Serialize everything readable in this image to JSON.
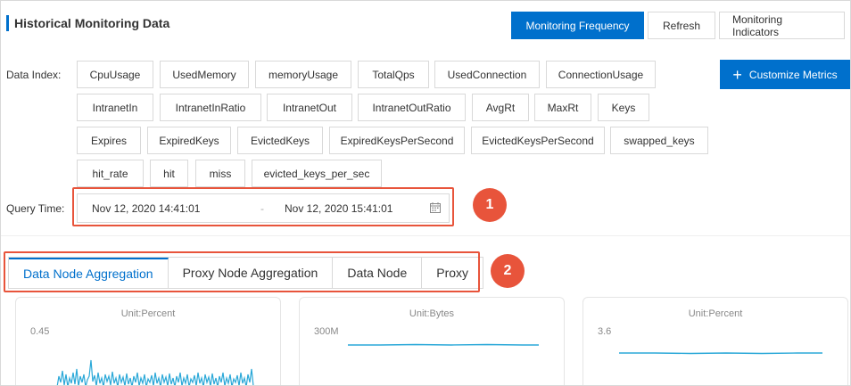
{
  "header": {
    "title": "Historical Monitoring Data",
    "buttons": [
      "Monitoring Frequency",
      "Refresh",
      "Monitoring Indicators"
    ]
  },
  "data_index": {
    "label": "Data Index:",
    "tags": [
      "CpuUsage",
      "UsedMemory",
      "memoryUsage",
      "TotalQps",
      "UsedConnection",
      "ConnectionUsage",
      "IntranetIn",
      "IntranetInRatio",
      "IntranetOut",
      "IntranetOutRatio",
      "AvgRt",
      "MaxRt",
      "Keys",
      "Expires",
      "ExpiredKeys",
      "EvictedKeys",
      "ExpiredKeysPerSecond",
      "EvictedKeysPerSecond",
      "swapped_keys",
      "hit_rate",
      "hit",
      "miss",
      "evicted_keys_per_sec"
    ],
    "customize_label": "Customize Metrics"
  },
  "query_time": {
    "label": "Query Time:",
    "start": "Nov 12, 2020 14:41:01",
    "separator": "-",
    "end": "Nov 12, 2020 15:41:01"
  },
  "callouts": [
    "1",
    "2"
  ],
  "tabs": [
    "Data Node Aggregation",
    "Proxy Node Aggregation",
    "Data Node",
    "Proxy"
  ],
  "active_tab": "Data Node Aggregation",
  "charts": [
    {
      "unit": "Unit:Percent",
      "tick": "0.45"
    },
    {
      "unit": "Unit:Bytes",
      "tick": "300M"
    },
    {
      "unit": "Unit:Percent",
      "tick": "3.6"
    }
  ],
  "colors": {
    "primary": "#0070cc",
    "callout": "#e8543b",
    "series": "#2aa8d8"
  }
}
